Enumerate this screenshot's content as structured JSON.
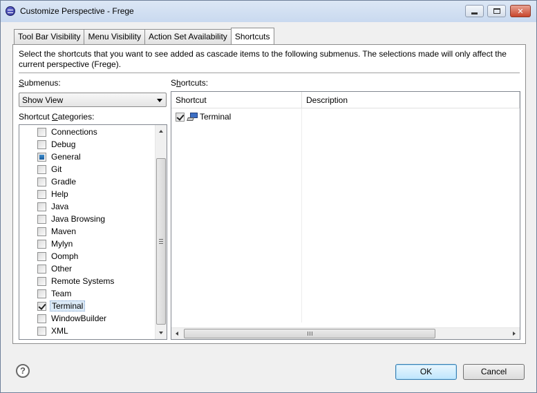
{
  "window": {
    "title": "Customize Perspective - Frege",
    "icon": "eclipse-icon"
  },
  "tabs": [
    {
      "label": "Tool Bar Visibility",
      "active": false
    },
    {
      "label": "Menu Visibility",
      "active": false
    },
    {
      "label": "Action Set Availability",
      "active": false
    },
    {
      "label": "Shortcuts",
      "active": true
    }
  ],
  "instructions": {
    "line1": "Select the shortcuts that you want to see added as cascade items to the following submenus.  The selections made will only affect the",
    "line2": "current perspective (Frege)."
  },
  "left": {
    "submenus_label_accel": "S",
    "submenus_label_rest": "ubmenus:",
    "submenu_selected": "Show View",
    "categories_label_pre": "Shortcut ",
    "categories_label_accel": "C",
    "categories_label_rest": "ategories:",
    "categories": [
      {
        "label": "Connections",
        "state": "unchecked"
      },
      {
        "label": "Debug",
        "state": "unchecked"
      },
      {
        "label": "General",
        "state": "partial"
      },
      {
        "label": "Git",
        "state": "unchecked"
      },
      {
        "label": "Gradle",
        "state": "unchecked"
      },
      {
        "label": "Help",
        "state": "unchecked"
      },
      {
        "label": "Java",
        "state": "unchecked"
      },
      {
        "label": "Java Browsing",
        "state": "unchecked"
      },
      {
        "label": "Maven",
        "state": "unchecked"
      },
      {
        "label": "Mylyn",
        "state": "unchecked"
      },
      {
        "label": "Oomph",
        "state": "unchecked"
      },
      {
        "label": "Other",
        "state": "unchecked"
      },
      {
        "label": "Remote Systems",
        "state": "unchecked"
      },
      {
        "label": "Team",
        "state": "unchecked"
      },
      {
        "label": "Terminal",
        "state": "checked",
        "selected": true
      },
      {
        "label": "WindowBuilder",
        "state": "unchecked"
      },
      {
        "label": "XML",
        "state": "unchecked"
      }
    ]
  },
  "right": {
    "shortcuts_label_accel": "h",
    "shortcuts_label_pre": "S",
    "shortcuts_label_rest": "ortcuts:",
    "columns": [
      "Shortcut",
      "Description"
    ],
    "rows": [
      {
        "shortcut": "Terminal",
        "description": "",
        "checked": true,
        "icon": "terminal-icon"
      }
    ]
  },
  "footer": {
    "help_icon": "help-icon",
    "help_glyph": "?",
    "ok_label": "OK",
    "cancel_label": "Cancel"
  }
}
